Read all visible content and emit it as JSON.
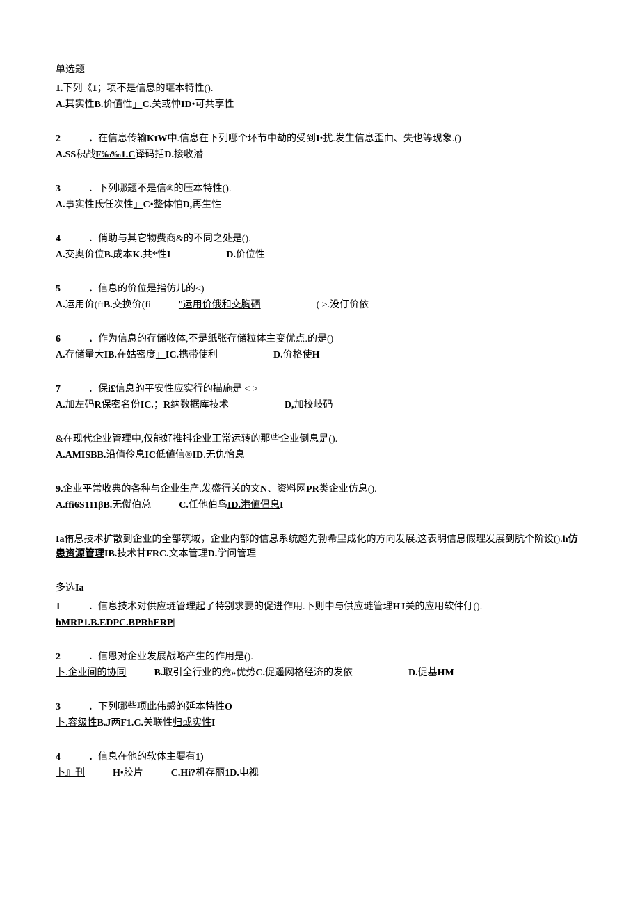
{
  "section1": "单选题",
  "q1": {
    "q": [
      "1.",
      "下列《",
      "1",
      "；项不是信息的堪本特性()."
    ],
    "opts": [
      "A.",
      "其实性",
      "B.",
      "价值性",
      "」",
      "C.",
      "关或忡",
      "ID",
      "•可共享性"
    ]
  },
  "q2": {
    "q": [
      "2",
      "．",
      "在信息传输",
      "KtW",
      "中.信息在下列哪个环节中劫的受到",
      "I",
      "•扰.发生信息歪曲、失也等现象.()"
    ],
    "opts": [
      "A.SS",
      "积战",
      "F‰‰1.C",
      "译码括",
      "D.",
      "接收潜"
    ]
  },
  "q3": {
    "q": [
      "3",
      "．下列哪题不是信®的压本特性()."
    ],
    "opts": [
      "A.",
      "事实性氐任次性",
      "」",
      "C",
      "•整体怕",
      "D,",
      "再生性"
    ]
  },
  "q4": {
    "q": [
      "4",
      "．俏助与其它物费商&的不同之处是()."
    ],
    "opts": [
      "A.",
      "交奥价位",
      "B.",
      "成本",
      "K.",
      "共*性",
      "I",
      "D.",
      "价位性"
    ]
  },
  "q5": {
    "q": [
      "5",
      "．",
      "信息的价位是指仿儿的<)"
    ],
    "opts": [
      "A.",
      "运用价(ft",
      "B.",
      "交换价(fi",
      "\"运用价俄和交胸硒",
      "( >.没仃价依"
    ]
  },
  "q6": {
    "q": [
      "6",
      "．",
      "作为信息的存储收体,不是纸张存储粒体主变优点.的是()"
    ],
    "opts": [
      "A.",
      "存储量大",
      "IB.",
      "在姑密度",
      "」",
      "IC.",
      "携带使利",
      "D.",
      "价格使",
      "H"
    ]
  },
  "q7": {
    "q": [
      "7",
      "．保",
      "i£",
      "信息的平安性应实行的描施是 < >"
    ],
    "opts": [
      "A.",
      "加左码",
      "R",
      "保密名份",
      "IC.",
      "；",
      "R",
      "纳数据库技术",
      "D,",
      "加校岐码"
    ]
  },
  "q8": {
    "q": [
      "&在现代企业管理中,仅能好推抖企业正常运转的那些企业倒息是()."
    ],
    "opts": [
      "A.AMISBB.",
      "沿值伶息",
      "IC",
      "低値信®",
      "ID",
      ".无仇怡息"
    ]
  },
  "q9": {
    "q": [
      "9.",
      "企业平常收典的各种与企业生产.发盛行关的文",
      "N",
      "、资料网",
      "PR",
      "类企业仿息()."
    ],
    "opts": [
      "A.ffi6S111βB.",
      "无僦伯总",
      "C.",
      "任他伯鸟",
      "ID.",
      "港値倡息",
      "I"
    ]
  },
  "q10": {
    "q": [
      "Ia",
      "侑息技术扩散到企业的全部筑域，企业内部的信息系统超先勃希里成化的方向发展.这表明信息假理发展到肮个阶设().",
      "h仿患资源管理",
      "IB.",
      "技术甘",
      "FRC.",
      "文本管理",
      "D.",
      "学问管理"
    ]
  },
  "section2": "多选Ia",
  "mq1": {
    "q": [
      "1",
      "．信息技术对供应琏管理起了特别求要的促进作用.下则中与供应琏管理",
      "HJ",
      "关的应用软件仃()."
    ],
    "opts": [
      "hMRP1.B.EDPC.BPRhERP|"
    ]
  },
  "mq2": {
    "q": [
      "2",
      "．信恩对企业发展战略产生的作用是()."
    ],
    "opts": [
      "卜.企业间的协同",
      "B.",
      "取引全行业的竞»优势",
      "C.",
      "促遥网格经济的发依",
      "D.",
      "促基",
      "HM"
    ]
  },
  "mq3": {
    "q": [
      "3",
      "．下列哪些项此伟感的延本特性",
      "O"
    ],
    "opts": [
      "卜.容级性",
      "B.J",
      "两",
      "F1.C.",
      "关联性",
      "归或实性",
      "I"
    ]
  },
  "mq4": {
    "q": [
      "4",
      "．",
      "信息在他的软体主要有",
      "1)"
    ],
    "opts": [
      "卜』刊",
      "H",
      "•胶片",
      "C.Hi?",
      "机存丽",
      "1D.",
      "电视"
    ]
  }
}
